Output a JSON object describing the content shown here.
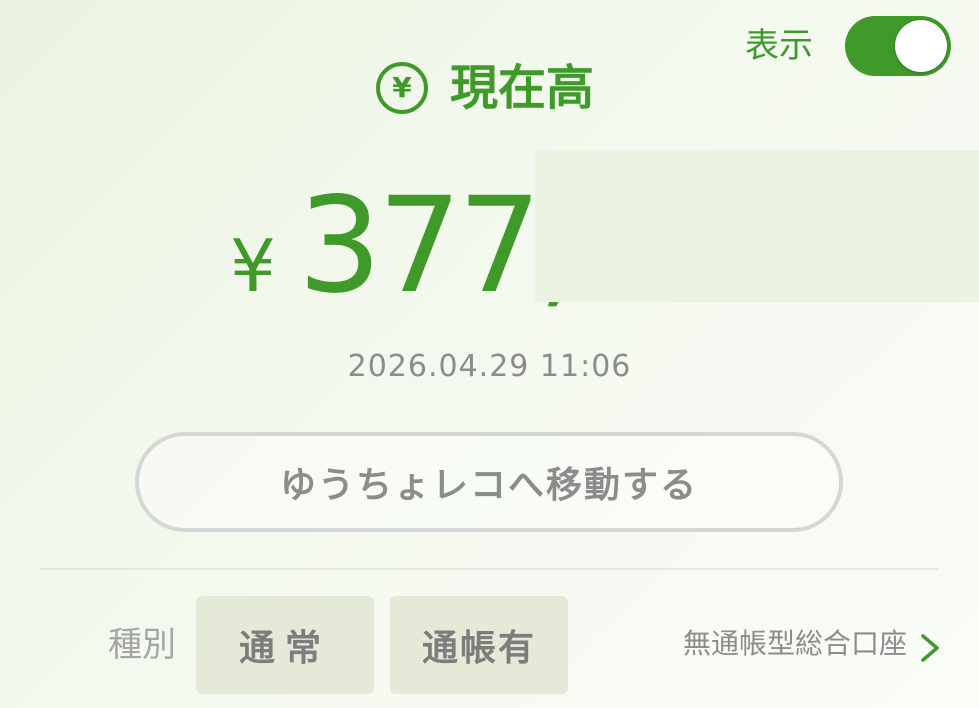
{
  "header": {
    "toggle_label": "表示",
    "toggle_on": true,
    "title": "現在高",
    "title_icon": "yen-circle-icon",
    "title_icon_glyph": "¥"
  },
  "balance": {
    "currency": "¥",
    "amount": "377,"
  },
  "timestamp": "2026.04.29 11:06",
  "actions": {
    "move_button_label": "ゆうちょレコへ移動する"
  },
  "account": {
    "type_label": "種別",
    "badges": [
      "通常",
      "通帳有"
    ],
    "account_type": "無通帳型総合口座",
    "chevron_icon": "chevron-right-icon"
  },
  "colors": {
    "accent": "#3f9a2a",
    "muted_text": "#8c8c8c",
    "badge_bg": "#e5ead8"
  }
}
